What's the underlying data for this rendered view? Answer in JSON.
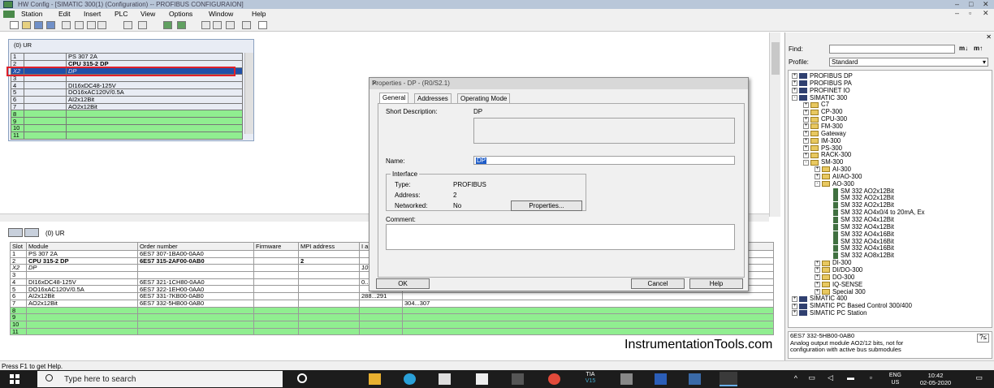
{
  "window": {
    "title": "HW Config - [SIMATIC 300(1) (Configuration) -- PROFIBUS CONFIGURAION]"
  },
  "menu": [
    "Station",
    "Edit",
    "Insert",
    "PLC",
    "View",
    "Options",
    "Window",
    "Help"
  ],
  "rack": {
    "title": "(0) UR",
    "rows": [
      {
        "slot": "1",
        "module": "PS 307 2A"
      },
      {
        "slot": "2",
        "module": "CPU 315-2 DP"
      },
      {
        "slot": "X2",
        "module": "DP"
      },
      {
        "slot": "3",
        "module": ""
      },
      {
        "slot": "4",
        "module": "DI16xDC48-125V"
      },
      {
        "slot": "5",
        "module": "DO16xAC120V/0.5A"
      },
      {
        "slot": "6",
        "module": "AI2x12Bit"
      },
      {
        "slot": "7",
        "module": "AO2x12Bit"
      },
      {
        "slot": "8",
        "module": ""
      },
      {
        "slot": "9",
        "module": ""
      },
      {
        "slot": "10",
        "module": ""
      },
      {
        "slot": "11",
        "module": ""
      }
    ]
  },
  "lower": {
    "title": "(0)  UR",
    "headers": [
      "Slot",
      "Module",
      "Order number",
      "Firmware",
      "MPI address",
      "I a"
    ],
    "rows": [
      {
        "slot": "1",
        "module": "PS 307 2A",
        "order": "6ES7 307-1BA00-0AA0",
        "fw": "",
        "mpi": "",
        "ia": "",
        "q": ""
      },
      {
        "slot": "2",
        "module": "CPU 315-2 DP",
        "order": "6ES7 315-2AF00-0AB0",
        "fw": "",
        "mpi": "2",
        "ia": "",
        "q": ""
      },
      {
        "slot": "X2",
        "module": "DP",
        "order": "",
        "fw": "",
        "mpi": "",
        "ia": "10",
        "q": ""
      },
      {
        "slot": "3",
        "module": "",
        "order": "",
        "fw": "",
        "mpi": "",
        "ia": "",
        "q": ""
      },
      {
        "slot": "4",
        "module": "DI16xDC48-125V",
        "order": "6ES7 321-1CH80-0AA0",
        "fw": "",
        "mpi": "",
        "ia": "0...",
        "q": ""
      },
      {
        "slot": "5",
        "module": "DO16xAC120V/0.5A",
        "order": "6ES7 322-1EH00-0AA0",
        "fw": "",
        "mpi": "",
        "ia": "",
        "q": ""
      },
      {
        "slot": "6",
        "module": "AI2x12Bit",
        "order": "6ES7 331-7KB00-0AB0",
        "fw": "",
        "mpi": "",
        "ia": "288...291",
        "q": ""
      },
      {
        "slot": "7",
        "module": "AO2x12Bit",
        "order": "6ES7 332-5HB00-0AB0",
        "fw": "",
        "mpi": "",
        "ia": "",
        "q": "304...307"
      },
      {
        "slot": "8",
        "module": "",
        "order": "",
        "fw": "",
        "mpi": "",
        "ia": "",
        "q": ""
      },
      {
        "slot": "9",
        "module": "",
        "order": "",
        "fw": "",
        "mpi": "",
        "ia": "",
        "q": ""
      },
      {
        "slot": "10",
        "module": "",
        "order": "",
        "fw": "",
        "mpi": "",
        "ia": "",
        "q": ""
      },
      {
        "slot": "11",
        "module": "",
        "order": "",
        "fw": "",
        "mpi": "",
        "ia": "",
        "q": ""
      }
    ]
  },
  "dialog": {
    "title": "Properties - DP - (R0/S2.1)",
    "tabs": [
      "General",
      "Addresses",
      "Operating Mode"
    ],
    "short_desc_label": "Short Description:",
    "short_desc_value": "DP",
    "name_label": "Name:",
    "name_value": "DP",
    "interface_label": "Interface",
    "type_label": "Type:",
    "type_value": "PROFIBUS",
    "address_label": "Address:",
    "address_value": "2",
    "networked_label": "Networked:",
    "networked_value": "No",
    "properties_button": "Properties...",
    "comment_label": "Comment:",
    "ok": "OK",
    "cancel": "Cancel",
    "help": "Help"
  },
  "catalog": {
    "find_label": "Find:",
    "profile_label": "Profile:",
    "profile_value": "Standard",
    "tree": [
      {
        "label": "PROFIBUS DP",
        "level": 0,
        "pm": "+",
        "icon": "net"
      },
      {
        "label": "PROFIBUS PA",
        "level": 0,
        "pm": "+",
        "icon": "net"
      },
      {
        "label": "PROFINET IO",
        "level": 0,
        "pm": "+",
        "icon": "net"
      },
      {
        "label": "SIMATIC 300",
        "level": 0,
        "pm": "-",
        "icon": "net"
      },
      {
        "label": "C7",
        "level": 1,
        "pm": "+",
        "icon": "fold"
      },
      {
        "label": "CP-300",
        "level": 1,
        "pm": "+",
        "icon": "fold"
      },
      {
        "label": "CPU-300",
        "level": 1,
        "pm": "+",
        "icon": "fold"
      },
      {
        "label": "FM-300",
        "level": 1,
        "pm": "+",
        "icon": "fold"
      },
      {
        "label": "Gateway",
        "level": 1,
        "pm": "+",
        "icon": "fold"
      },
      {
        "label": "IM-300",
        "level": 1,
        "pm": "+",
        "icon": "fold"
      },
      {
        "label": "PS-300",
        "level": 1,
        "pm": "+",
        "icon": "fold"
      },
      {
        "label": "RACK-300",
        "level": 1,
        "pm": "+",
        "icon": "fold"
      },
      {
        "label": "SM-300",
        "level": 1,
        "pm": "-",
        "icon": "fold"
      },
      {
        "label": "AI-300",
        "level": 2,
        "pm": "+",
        "icon": "fold"
      },
      {
        "label": "AI/AO-300",
        "level": 2,
        "pm": "+",
        "icon": "fold"
      },
      {
        "label": "AO-300",
        "level": 2,
        "pm": "-",
        "icon": "fold"
      },
      {
        "label": "SM 332 AO2x12Bit",
        "level": 3,
        "pm": "",
        "icon": "mod"
      },
      {
        "label": "SM 332 AO2x12Bit",
        "level": 3,
        "pm": "",
        "icon": "mod"
      },
      {
        "label": "SM 332 AO2x12Bit",
        "level": 3,
        "pm": "",
        "icon": "mod"
      },
      {
        "label": "SM 332 AO4x0/4 to 20mA, Ex",
        "level": 3,
        "pm": "",
        "icon": "mod"
      },
      {
        "label": "SM 332 AO4x12Bit",
        "level": 3,
        "pm": "",
        "icon": "mod"
      },
      {
        "label": "SM 332 AO4x12Bit",
        "level": 3,
        "pm": "",
        "icon": "mod"
      },
      {
        "label": "SM 332 AO4x16Bit",
        "level": 3,
        "pm": "",
        "icon": "mod"
      },
      {
        "label": "SM 332 AO4x16Bit",
        "level": 3,
        "pm": "",
        "icon": "mod"
      },
      {
        "label": "SM 332 AO4x16Bit",
        "level": 3,
        "pm": "",
        "icon": "mod"
      },
      {
        "label": "SM 332 AO8x12Bit",
        "level": 3,
        "pm": "",
        "icon": "mod"
      },
      {
        "label": "DI-300",
        "level": 2,
        "pm": "+",
        "icon": "fold"
      },
      {
        "label": "DI/DO-300",
        "level": 2,
        "pm": "+",
        "icon": "fold"
      },
      {
        "label": "DO-300",
        "level": 2,
        "pm": "+",
        "icon": "fold"
      },
      {
        "label": "IQ-SENSE",
        "level": 2,
        "pm": "+",
        "icon": "fold"
      },
      {
        "label": "Special 300",
        "level": 2,
        "pm": "+",
        "icon": "fold"
      },
      {
        "label": "SIMATIC 400",
        "level": 0,
        "pm": "+",
        "icon": "net"
      },
      {
        "label": "SIMATIC PC Based Control 300/400",
        "level": 0,
        "pm": "+",
        "icon": "net"
      },
      {
        "label": "SIMATIC PC Station",
        "level": 0,
        "pm": "+",
        "icon": "net"
      }
    ],
    "info_order": "6ES7 332-5HB00-0AB0",
    "info_text1": "Analog output module AO2/12 bits, not for",
    "info_text2": "configuration with active bus submodules"
  },
  "status": "Press F1 to get Help.",
  "watermark": "InstrumentationTools.com",
  "taskbar": {
    "search_placeholder": "Type here to search",
    "tia_label1": "TIA",
    "tia_label2": "V15",
    "lang1": "ENG",
    "lang2": "US",
    "time": "10:42",
    "date": "02-05-2020"
  },
  "colors": {
    "empty_slot_green": "#90ee90",
    "selected_row_blue": "#2050a8",
    "highlight_red": "#e0202a"
  }
}
